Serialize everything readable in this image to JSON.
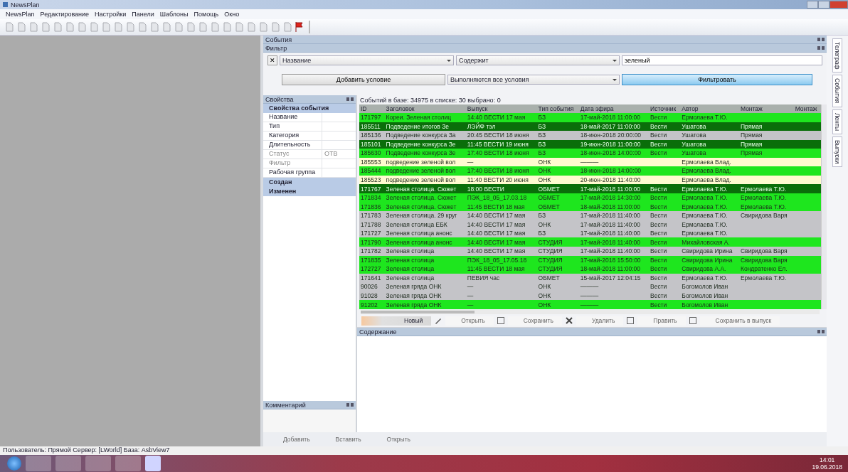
{
  "window": {
    "title": "NewsPlan"
  },
  "menu": [
    "NewsPlan",
    "Редактирование",
    "Настройки",
    "Панели",
    "Шаблоны",
    "Помощь",
    "Окно"
  ],
  "events_panel": {
    "title": "События"
  },
  "filter": {
    "title": "Фильтр",
    "remove": "✕",
    "field": "Название",
    "operator": "Содержит",
    "value": "зеленый",
    "add_button": "Добавить условие",
    "mode": "Выполняются все условия",
    "apply_button": "Фильтровать"
  },
  "properties": {
    "title": "Свойства",
    "header": "Свойства события",
    "rows": [
      {
        "label": "Название",
        "value": "",
        "disabled": false
      },
      {
        "label": "Тип",
        "value": "",
        "disabled": false
      },
      {
        "label": "Категория",
        "value": "",
        "disabled": false
      },
      {
        "label": "Длительность",
        "value": "",
        "disabled": false
      },
      {
        "label": "Статус",
        "value": "ОТВ",
        "disabled": true
      },
      {
        "label": "Фильтр",
        "value": "",
        "disabled": true
      },
      {
        "label": "Рабочая группа",
        "value": "",
        "disabled": false
      }
    ],
    "groups": [
      "Создан",
      "Изменен"
    ]
  },
  "comment_panel": {
    "title": "Комментарий"
  },
  "grid": {
    "summary": "Событий в базе: 34975 в списке: 30 выбрано: 0",
    "columns": [
      "ID",
      "Заголовок",
      "Выпуск",
      "Тип события",
      "Дата эфира",
      "Источник",
      "Автор",
      "Монтаж",
      "Монтаж"
    ],
    "rows": [
      {
        "color": "#1ee61e",
        "cells": [
          "171797",
          "Кореи. Зеленая столиц",
          "14:40 ВЕСТИ 17 мая",
          "БЗ",
          "17-май-2018 11:00:00",
          "Вести",
          "Ермолаева Т.Ю.",
          "",
          ""
        ]
      },
      {
        "color": "#0a6e0a",
        "cells": [
          "185511",
          "Подведение итогов Зе",
          "ЛЭЙФ тэл",
          "БЗ",
          "18-май-2017 11:00:00",
          "Вести",
          "Ушатова",
          "Прямая",
          ""
        ]
      },
      {
        "color": "#c4c4c8",
        "cells": [
          "185136",
          "Подведение конкурса За",
          "20:45 ВЕСТИ 18 июня",
          "БЗ",
          "18-июн-2018 20:00:00",
          "Вести",
          "Ушатова",
          "Прямая",
          ""
        ]
      },
      {
        "color": "#0a6e0a",
        "cells": [
          "185101",
          "Подведение конкурса Зе",
          "11:45 ВЕСТИ 19 июня",
          "БЗ",
          "19-июн-2018 11:00:00",
          "Вести",
          "Ушатова",
          "Прямая",
          ""
        ]
      },
      {
        "color": "#1ee61e",
        "cells": [
          "185630",
          "Подведение конкурса Зе",
          "17:40 ВЕСТИ 18 июня",
          "БЗ",
          "18-июн-2018 14:00:00",
          "Вести",
          "Ушатова",
          "Прямая",
          ""
        ]
      },
      {
        "color": "#fffbd0",
        "cells": [
          "185553",
          "подведение зеленой вол",
          "—",
          "ОНК",
          "———",
          "",
          "Ермолаева Влад.",
          "",
          ""
        ]
      },
      {
        "color": "#1ee61e",
        "cells": [
          "185444",
          "подведение зеленой вол",
          "17:40 ВЕСТИ 18 июня",
          "ОНК",
          "18-июн-2018 14:00:00",
          "",
          "Ермолаева Влад.",
          "",
          ""
        ]
      },
      {
        "color": "#fffbd0",
        "cells": [
          "185523",
          "подведение зеленой вол",
          "11:40 ВЕСТИ 20 июня",
          "ОНК",
          "20-июн-2018 11:40:00",
          "",
          "Ермолаева Влад.",
          "",
          ""
        ]
      },
      {
        "color": "#0a6e0a",
        "cells": [
          "171767",
          "Зеленая столица. Сюжет",
          "18:00 ВЕСТИ",
          "ОБМЕТ",
          "17-май-2018 11:00:00",
          "Вести",
          "Ермолаева Т.Ю.",
          "Ермолаева Т.Ю.",
          ""
        ]
      },
      {
        "color": "#1ee61e",
        "cells": [
          "171834",
          "Зеленая столица. Сюжет",
          "ПЭК_18_05_17.03.18",
          "ОБМЕТ",
          "17-май-2018 14:30:00",
          "Вести",
          "Ермолаева Т.Ю.",
          "Ермолаева Т.Ю.",
          ""
        ]
      },
      {
        "color": "#1ee61e",
        "cells": [
          "171836",
          "Зеленая столица. Сюжет",
          "11:45 ВЕСТИ 18 мая",
          "ОБМЕТ",
          "18-май-2018 11:00:00",
          "Вести",
          "Ермолаева Т.Ю.",
          "Ермолаева Т.Ю.",
          ""
        ]
      },
      {
        "color": "#c4c4c8",
        "cells": [
          "171783",
          "Зеленая столица. 29 круг",
          "14:40 ВЕСТИ 17 мая",
          "БЗ",
          "17-май-2018 11:40:00",
          "Вести",
          "Ермолаева Т.Ю.",
          "Свиридова Варя",
          ""
        ]
      },
      {
        "color": "#c4c4c8",
        "cells": [
          "171788",
          "Зеленая столица ЕБК",
          "14:40 ВЕСТИ 17 мая",
          "ОНК",
          "17-май-2018 11:40:00",
          "Вести",
          "Ермолаева Т.Ю.",
          "",
          ""
        ]
      },
      {
        "color": "#c4c4c8",
        "cells": [
          "171727",
          "Зеленая столица анонс",
          "14:40 ВЕСТИ 17 мая",
          "БЗ",
          "17-май-2018 11:40:00",
          "Вести",
          "Ермолаева Т.Ю.",
          "",
          ""
        ]
      },
      {
        "color": "#1ee61e",
        "cells": [
          "171790",
          "Зеленая столица анонс",
          "14:40 ВЕСТИ 17 мая",
          "СТУДИЯ",
          "17-май-2018 11:40:00",
          "Вести",
          "Михайловская А.",
          "",
          ""
        ]
      },
      {
        "color": "#c4c4c8",
        "cells": [
          "171782",
          "Зеленая столица",
          "14:40 ВЕСТИ 17 мая",
          "СТУДИЯ",
          "17-май-2018 11:40:00",
          "Вести",
          "Свиридова Ирина",
          "Свиридова Варя",
          ""
        ]
      },
      {
        "color": "#1ee61e",
        "cells": [
          "171835",
          "Зеленая столица",
          "ПЭК_18_05_17.05.18",
          "СТУДИЯ",
          "17-май-2018 15:50:00",
          "Вести",
          "Свиридова Ирина",
          "Свиридова Варя",
          ""
        ]
      },
      {
        "color": "#1ee61e",
        "cells": [
          "172727",
          "Зеленая столица",
          "11:45 ВЕСТИ 18 мая",
          "СТУДИЯ",
          "18-май-2018 11:00:00",
          "Вести",
          "Свиридова А.А.",
          "Кондратенко Ел.",
          ""
        ]
      },
      {
        "color": "#c4c4c8",
        "cells": [
          "171641",
          "Зеленая столица",
          "ПЕВИЯ час",
          "ОБМЕТ",
          "15-май-2017 12:04:15",
          "Вести",
          "Ермолаева Т.Ю.",
          "Ермолаева Т.Ю.",
          ""
        ]
      },
      {
        "color": "#c4c4c8",
        "cells": [
          "90026",
          "Зеленая гряда ОНК",
          "—",
          "ОНК",
          "———",
          "Вести",
          "Богомолов Иван",
          "",
          ""
        ]
      },
      {
        "color": "#c4c4c8",
        "cells": [
          "91028",
          "Зеленая гряда ОНК",
          "—",
          "ОНК",
          "———",
          "Вести",
          "Богомолов Иван",
          "",
          ""
        ]
      },
      {
        "color": "#1ee61e",
        "cells": [
          "91202",
          "Зеленая гряда ОНК",
          "—",
          "ОНК",
          "———",
          "Вести",
          "Богомолов Иван",
          "",
          ""
        ]
      }
    ]
  },
  "grid_toolbar": [
    "Новый",
    "Открыть",
    "Сохранить",
    "Удалить",
    "Править",
    "Сохранить в выпуск"
  ],
  "content_panel": {
    "title": "Содержание"
  },
  "bottom_toolbar": [
    "Добавить",
    "Вставить",
    "Открыть"
  ],
  "side_tabs": [
    "Телеграф",
    "События",
    "Ленты",
    "Выпуски"
  ],
  "status_bar": "Пользователь: Прямой   Сервер: [LWorld]   База: AsbView7",
  "taskbar": {
    "time": "14:01",
    "date": "19.06.2018"
  }
}
